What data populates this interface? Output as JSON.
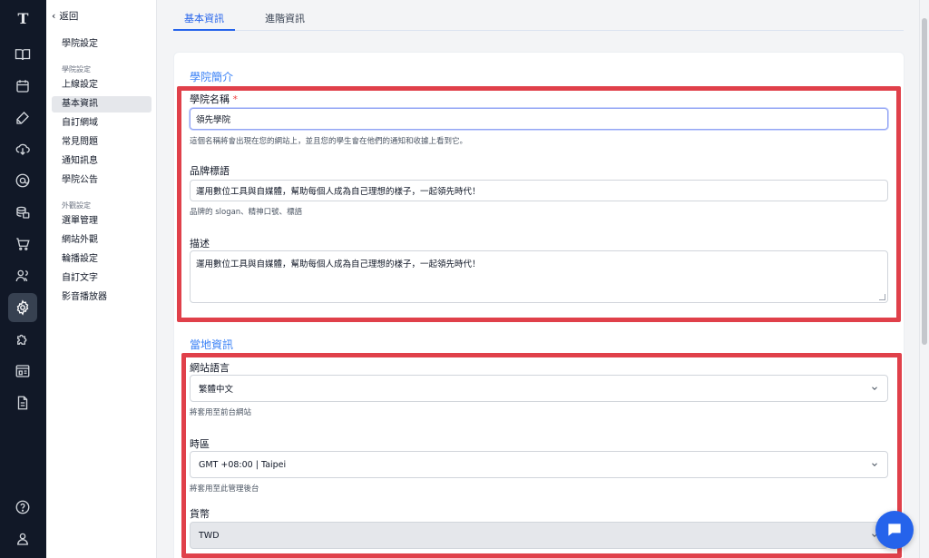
{
  "rail": {
    "logo": "T"
  },
  "sidebar": {
    "back_label": "返回",
    "top_item": "學院設定",
    "group1_label": "學院設定",
    "group1_items": [
      "上線設定",
      "基本資訊",
      "自訂網域",
      "常見問題",
      "通知訊息",
      "學院公告"
    ],
    "group2_label": "外觀設定",
    "group2_items": [
      "選單管理",
      "網站外觀",
      "輪播設定",
      "自訂文字",
      "影音播放器"
    ]
  },
  "tabs": [
    "基本資訊",
    "進階資訊"
  ],
  "intro": {
    "title": "學院簡介",
    "name_label": "學院名稱",
    "name_required": "*",
    "name_value": "領先學院",
    "name_hint": "這個名稱將會出現在您的網站上，並且您的學生會在他們的通知和收據上看到它。",
    "slogan_label": "品牌標語",
    "slogan_value": "運用數位工具與自媒體，幫助每個人成為自己理想的樣子，一起領先時代！",
    "slogan_hint": "品牌的 slogan、精神口號、標語",
    "desc_label": "描述",
    "desc_value": "運用數位工具與自媒體，幫助每個人成為自己理想的樣子，一起領先時代！"
  },
  "local": {
    "title": "當地資訊",
    "lang_label": "網站語言",
    "lang_value": "繁體中文",
    "lang_hint": "將套用至前台網站",
    "tz_label": "時區",
    "tz_value": "GMT +08:00 | Taipei",
    "tz_hint": "將套用至此管理後台",
    "currency_label": "貨幣",
    "currency_value": "TWD"
  },
  "colors": {
    "accent": "#2563eb",
    "highlight": "#e0404a",
    "rail": "#111827"
  }
}
